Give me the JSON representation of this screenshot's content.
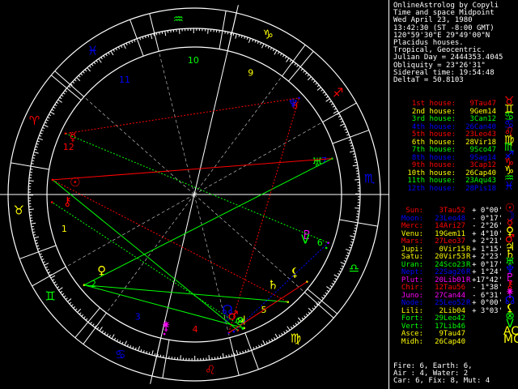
{
  "header": {
    "lines": [
      "OnlineAstrolog by Copyli",
      "Time and space Midpoint",
      "Wed April 23, 1980",
      "13:42:30 (ST -8:00 GMT)",
      "120°59'30\"E 29°49'00\"N",
      "Placidus houses.",
      "Tropical, Geocentric.",
      "Julian Day = 2444353.4045",
      "Obliquity = 23°26'31\"",
      "Sidereal time: 19:54:48",
      "DeltaT = 50.8103"
    ]
  },
  "houses": [
    {
      "label": "1st house:",
      "value": "9Tau47",
      "symbol": "♉",
      "color": "#ff0000"
    },
    {
      "label": "2nd house:",
      "value": "9Gem14",
      "symbol": "♊",
      "color": "#ffff00"
    },
    {
      "label": "3rd house:",
      "value": "3Can12",
      "symbol": "♋",
      "color": "#00ff00"
    },
    {
      "label": "4th house:",
      "value": "26Can40",
      "symbol": "♋",
      "color": "#0000ff"
    },
    {
      "label": "5th house:",
      "value": "23Leo43",
      "symbol": "♌",
      "color": "#ff0000"
    },
    {
      "label": "6th house:",
      "value": "28Vir18",
      "symbol": "♍",
      "color": "#ffff00"
    },
    {
      "label": "7th house:",
      "value": "9Sco47",
      "symbol": "♏",
      "color": "#00ff00"
    },
    {
      "label": "8th house:",
      "value": "9Sag14",
      "symbol": "♐",
      "color": "#0000ff"
    },
    {
      "label": "9th house:",
      "value": "3Cap12",
      "symbol": "♑",
      "color": "#ff0000"
    },
    {
      "label": "10th house:",
      "value": "26Cap40",
      "symbol": "♑",
      "color": "#ffff00"
    },
    {
      "label": "11th house:",
      "value": "23Aqu43",
      "symbol": "♒",
      "color": "#00ff00"
    },
    {
      "label": "12th house:",
      "value": "28Pis18",
      "symbol": "♓",
      "color": "#0000ff"
    }
  ],
  "planets": [
    {
      "name": "Sun:",
      "pos": "3Tau52",
      "rx": "",
      "speed": "+ 0°00'",
      "symbol": "☉",
      "color": "#ff0000"
    },
    {
      "name": "Moon:",
      "pos": "23Leo48",
      "rx": "",
      "speed": "- 0°17'",
      "symbol": "☽",
      "color": "#0000ff"
    },
    {
      "name": "Merc:",
      "pos": "14Ari27",
      "rx": "",
      "speed": "- 2°26'",
      "symbol": "☿",
      "color": "#ff0000"
    },
    {
      "name": "Venu:",
      "pos": "19Gem11",
      "rx": "",
      "speed": "+ 4°10'",
      "symbol": "♀",
      "color": "#ffff00"
    },
    {
      "name": "Mars:",
      "pos": "27Leo37",
      "rx": "",
      "speed": "+ 2°21'",
      "symbol": "♂",
      "color": "#ff0000"
    },
    {
      "name": "Jupi:",
      "pos": "0Vir15",
      "rx": "R",
      "speed": "+ 1°15'",
      "symbol": "♃",
      "color": "#ffff00"
    },
    {
      "name": "Satu:",
      "pos": "20Vir53",
      "rx": "R",
      "speed": "+ 2°23'",
      "symbol": "♄",
      "color": "#ffff00"
    },
    {
      "name": "Uran:",
      "pos": "24Sco23",
      "rx": "R",
      "speed": "+ 0°17'",
      "symbol": "♅",
      "color": "#00ff00"
    },
    {
      "name": "Nept:",
      "pos": "22Sag26",
      "rx": "R",
      "speed": "+ 1°24'",
      "symbol": "♆",
      "color": "#0000ff"
    },
    {
      "name": "Plut:",
      "pos": "20Lib01",
      "rx": "R",
      "speed": "+17°42'",
      "symbol": "♇",
      "color": "#ff00ff"
    },
    {
      "name": "Chir:",
      "pos": "12Tau56",
      "rx": "",
      "speed": "- 1°38'",
      "symbol": "⚷",
      "color": "#ff0000"
    },
    {
      "name": "Juno:",
      "pos": "27Can44",
      "rx": "",
      "speed": "- 6°31'",
      "symbol": "⚵",
      "color": "#ff00ff"
    },
    {
      "name": "Node:",
      "pos": "25Leo52",
      "rx": "R",
      "speed": "+ 0°00'",
      "symbol": "☊",
      "color": "#0000ff"
    },
    {
      "name": "Lili:",
      "pos": "2Lib04",
      "rx": "",
      "speed": "+ 3°03'",
      "symbol": "⚸",
      "color": "#ffff00"
    },
    {
      "name": "Fort:",
      "pos": "29Leo42",
      "rx": "",
      "speed": "",
      "symbol": "⊗",
      "color": "#00ff00"
    },
    {
      "name": "Vert:",
      "pos": "17Lib46",
      "rx": "",
      "speed": "",
      "symbol": "V",
      "color": "#00ff00"
    },
    {
      "name": "Asce:",
      "pos": "9Tau47",
      "rx": "",
      "speed": "",
      "symbol": "AC",
      "color": "#ffff00"
    },
    {
      "name": "Midh:",
      "pos": "26Cap40",
      "rx": "",
      "speed": "",
      "symbol": "MC",
      "color": "#ffff00"
    }
  ],
  "elements": {
    "line1": "Fire: 6, Earth: 6,",
    "line2": "Air : 4, Water: 2",
    "line3": "Car: 6, Fix: 8, Mut: 4"
  },
  "wheel": {
    "signs": [
      "♈",
      "♉",
      "♊",
      "♋",
      "♌",
      "♍",
      "♎",
      "♏",
      "♐",
      "♑",
      "♒",
      "♓"
    ],
    "sign_colors": [
      "#ff0000",
      "#ffff00",
      "#00ff00",
      "#0000ff",
      "#ff0000",
      "#ffff00",
      "#00ff00",
      "#0000ff",
      "#ff0000",
      "#ffff00",
      "#00ff00",
      "#0000ff"
    ],
    "house_numbers": [
      "1",
      "2",
      "3",
      "4",
      "5",
      "6",
      "7",
      "8",
      "9",
      "10",
      "11",
      "12"
    ]
  }
}
